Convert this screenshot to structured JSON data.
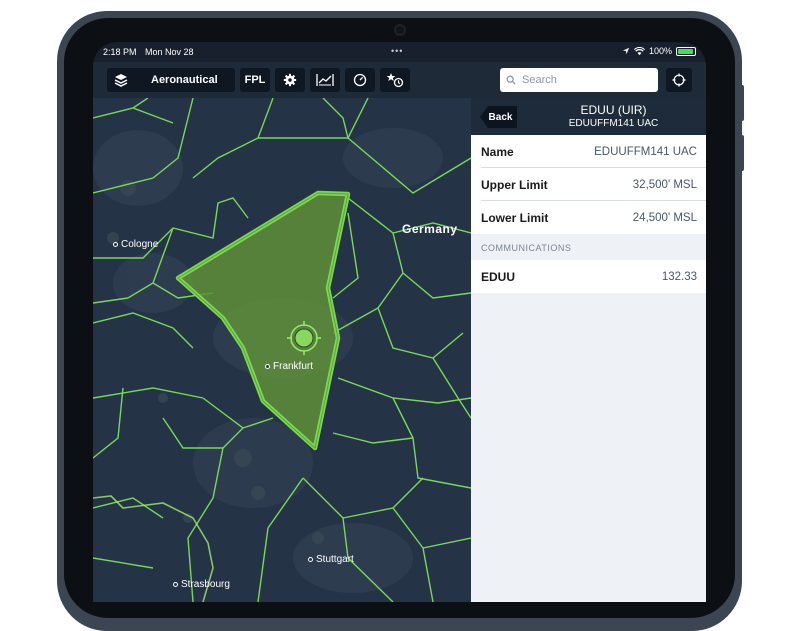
{
  "status_bar": {
    "time": "2:18 PM",
    "date": "Mon Nov 28",
    "battery": "100%"
  },
  "toolbar": {
    "layer_label": "Aeronautical",
    "fpl_label": "FPL",
    "search_placeholder": "Search",
    "icons": [
      "layers-icon",
      "gear-icon",
      "profile-icon",
      "timer-icon",
      "favorite-clock-icon",
      "locate-icon"
    ]
  },
  "map": {
    "country_label": "Germany",
    "cities": [
      {
        "name": "Cologne"
      },
      {
        "name": "Frankfurt"
      },
      {
        "name": "Stuttgart"
      },
      {
        "name": "Strasbourg"
      }
    ],
    "colors": {
      "background": "#253347",
      "boundary": "#7ee05a",
      "airspace_fill": "#5f8f3a",
      "airspace_stroke": "#7bd94e"
    }
  },
  "panel": {
    "back_label": "Back",
    "title": "EDUU (UIR)",
    "subtitle": "EDUUFFM141 UAC",
    "rows": [
      {
        "label": "Name",
        "value": "EDUUFFM141 UAC"
      },
      {
        "label": "Upper Limit",
        "value": "32,500' MSL"
      },
      {
        "label": "Lower Limit",
        "value": "24,500' MSL"
      }
    ],
    "section_title": "COMMUNICATIONS",
    "comms": [
      {
        "label": "EDUU",
        "value": "132.33"
      }
    ]
  }
}
